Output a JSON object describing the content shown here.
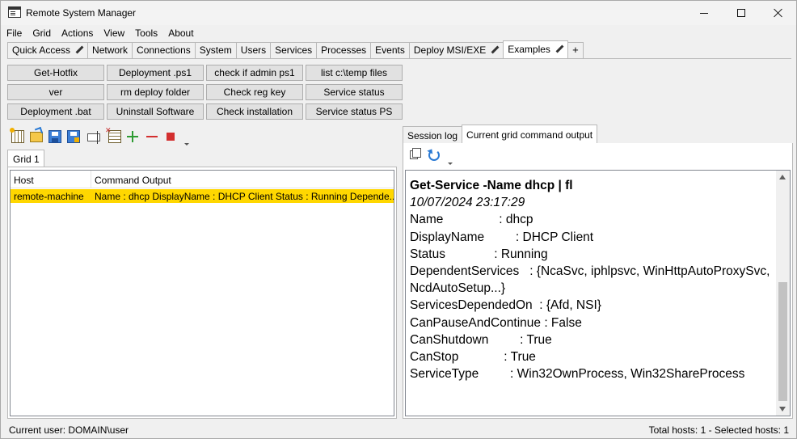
{
  "window": {
    "title": "Remote System Manager"
  },
  "menu": [
    "File",
    "Grid",
    "Actions",
    "View",
    "Tools",
    "About"
  ],
  "tabs": [
    {
      "label": "Quick Access",
      "editable": true
    },
    {
      "label": "Network"
    },
    {
      "label": "Connections"
    },
    {
      "label": "System"
    },
    {
      "label": "Users"
    },
    {
      "label": "Services"
    },
    {
      "label": "Processes"
    },
    {
      "label": "Events"
    },
    {
      "label": "Deploy MSI/EXE",
      "editable": true
    },
    {
      "label": "Examples",
      "editable": true,
      "active": true
    },
    {
      "label": "+"
    }
  ],
  "actions": [
    "Get-Hotfix",
    "Deployment .ps1",
    "check if admin ps1",
    "list c:\\temp files",
    "ver",
    "rm deploy folder",
    "Check reg key",
    "Service status",
    "Deployment .bat",
    "Uninstall Software",
    "Check installation",
    "Service status PS"
  ],
  "toolbar": {
    "icons": [
      "new-grid-icon",
      "open-icon",
      "save-icon",
      "save-as-icon",
      "rename-icon",
      "remove-columns-icon",
      "add-icon",
      "remove-icon",
      "stop-icon"
    ]
  },
  "grid": {
    "tab_label": "Grid 1",
    "columns": [
      "Host",
      "Command Output"
    ],
    "rows": [
      {
        "host": "remote-machine",
        "output": "Name : dhcp DisplayName : DHCP Client Status : Running Depende...",
        "selected": true
      }
    ],
    "selected_row_color": "#ffd700"
  },
  "right_pane": {
    "tabs": [
      "Session log",
      "Current grid command output"
    ],
    "active_tab": "Current grid command output",
    "output": {
      "command": "Get-Service -Name dhcp | fl",
      "timestamp": "10/07/2024 23:17:29",
      "lines": [
        "Name                : dhcp",
        "DisplayName         : DHCP Client",
        "Status              : Running",
        "DependentServices   : {NcaSvc, iphlpsvc, WinHttpAutoProxySvc, NcdAutoSetup...}",
        "ServicesDependedOn  : {Afd, NSI}",
        "CanPauseAndContinue : False",
        "CanShutdown         : True",
        "CanStop             : True",
        "ServiceType         : Win32OwnProcess, Win32ShareProcess"
      ]
    }
  },
  "status": {
    "current_user": "Current user: DOMAIN\\user",
    "hosts": "Total hosts: 1 - Selected hosts: 1"
  }
}
